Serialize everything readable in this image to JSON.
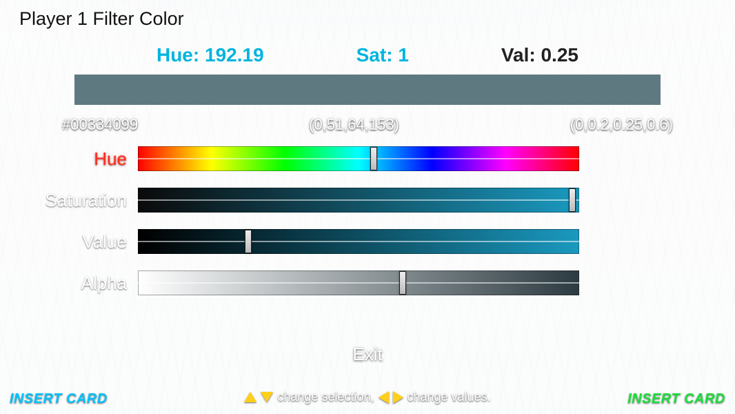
{
  "title": "Player 1 Filter Color",
  "summary": {
    "hue_label": "Hue:",
    "hue_value": "192.19",
    "sat_label": "Sat:",
    "sat_value": "1",
    "val_label": "Val:",
    "val_value": "0.25"
  },
  "swatch_color": "#5f7981",
  "formats": {
    "hex": "#00334099",
    "rgba255": "(0,51,64,153)",
    "rgba01": "(0,0.2,0.25,0.6)"
  },
  "sliders": {
    "hue": {
      "label": "Hue",
      "pos": 0.534,
      "selected": true
    },
    "saturation": {
      "label": "Saturation",
      "pos": 0.985,
      "selected": false
    },
    "value": {
      "label": "Value",
      "pos": 0.25,
      "selected": false
    },
    "alpha": {
      "label": "Alpha",
      "pos": 0.6,
      "selected": false
    }
  },
  "gradient_end": "#1a99bf",
  "exit_label": "Exit",
  "hint": {
    "part1": "change selection,",
    "part2": "change values."
  },
  "insert_card": {
    "left": "INSERT CARD",
    "right": "INSERT CARD"
  }
}
